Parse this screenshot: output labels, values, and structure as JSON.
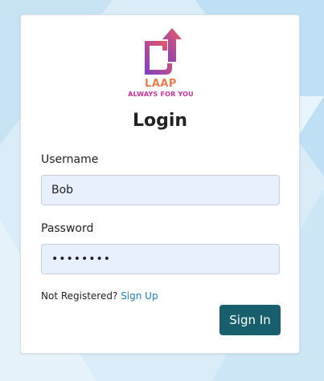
{
  "logo": {
    "name": "LAAP",
    "tagline": "ALWAYS FOR YOU"
  },
  "login": {
    "title": "Login",
    "username_label": "Username",
    "username_value": "Bob",
    "password_label": "Password",
    "password_value": "••••••••",
    "register_prompt": "Not Registered?",
    "register_link": "Sign Up",
    "signin_label": "Sign In"
  },
  "colors": {
    "primary_button": "#175f6d",
    "link": "#1a7fc1",
    "input_background": "#e8f0fe",
    "logo_gradient_start": "#7b3fc9",
    "logo_gradient_end": "#f05a5a"
  },
  "icons": {
    "logo": "upload-arrow-document-logo"
  }
}
